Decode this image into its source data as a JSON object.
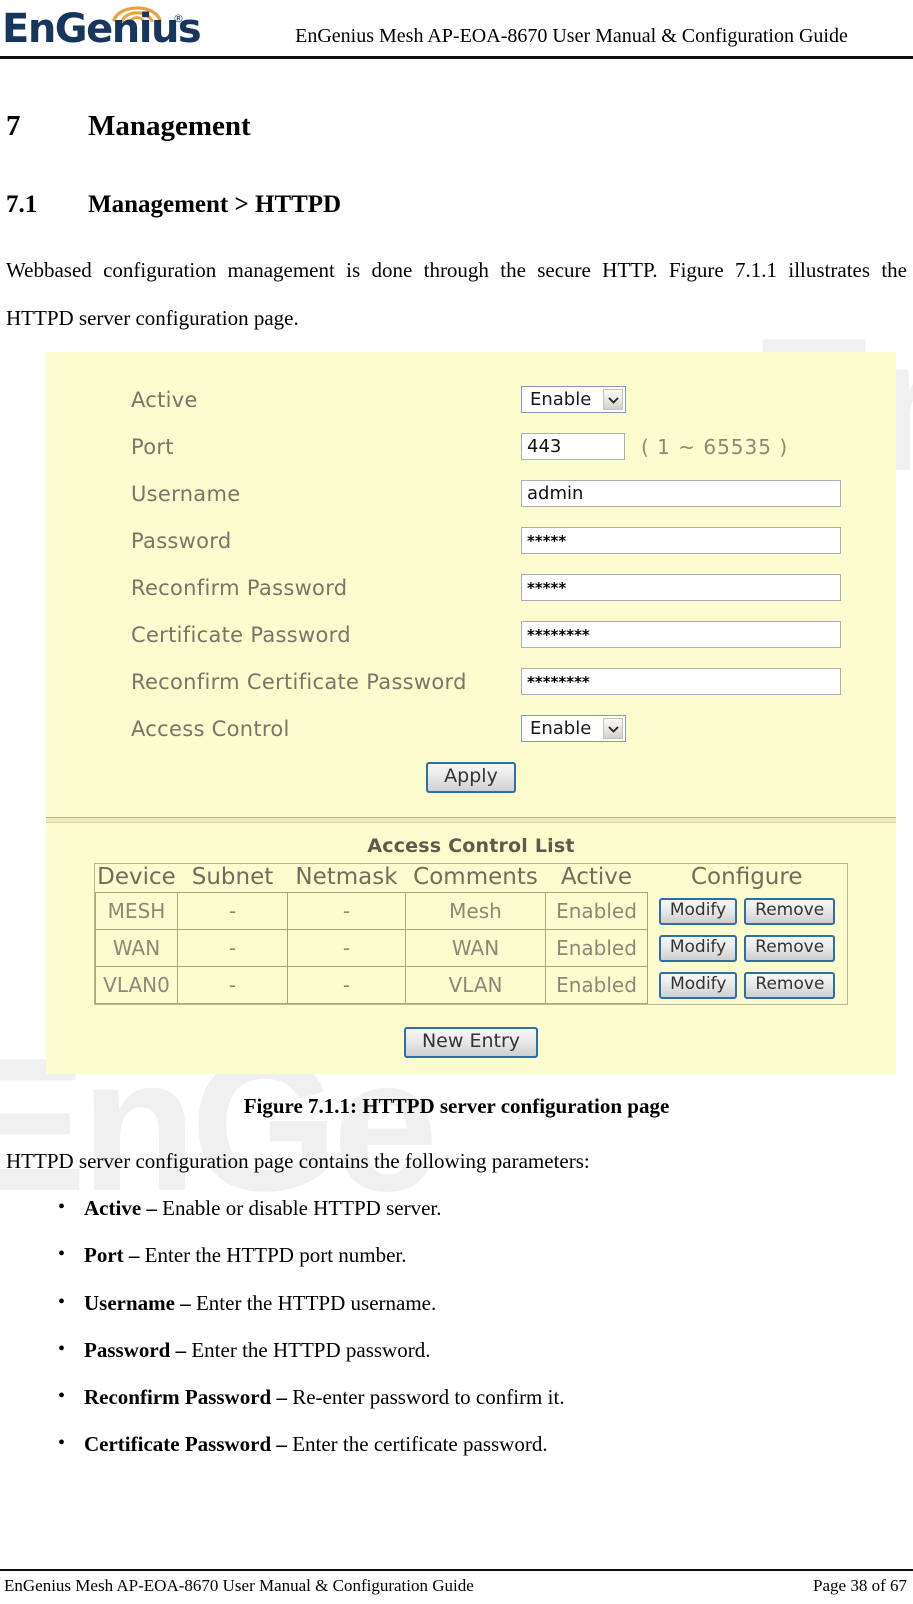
{
  "header": {
    "logo_text": "EnGenius",
    "logo_registered": "®",
    "title": "EnGenius Mesh AP-EOA-8670 User Manual & Configuration Guide"
  },
  "watermark": {
    "part1": "EnG",
    "part2": "EnGe"
  },
  "section": {
    "number": "7",
    "title": "Management"
  },
  "subsection": {
    "number": "7.1",
    "title": "Management > HTTPD"
  },
  "intro_paragraph": "Webbased configuration management is done through the secure HTTP. Figure 7.1.1 illustrates the HTTPD server configuration page.",
  "figure": {
    "caption": "Figure 7.1.1: HTTPD server configuration page",
    "form": {
      "rows": [
        {
          "label": "Active",
          "control": "select",
          "value": "Enable"
        },
        {
          "label": "Port",
          "control": "text",
          "value": "443",
          "hint": "( 1 ~ 65535 )"
        },
        {
          "label": "Username",
          "control": "text",
          "value": "admin"
        },
        {
          "label": "Password",
          "control": "password",
          "value": "*****"
        },
        {
          "label": "Reconfirm Password",
          "control": "password",
          "value": "*****"
        },
        {
          "label": "Certificate Password",
          "control": "password",
          "value": "********"
        },
        {
          "label": "Reconfirm Certificate Password",
          "control": "password",
          "value": "********"
        },
        {
          "label": "Access Control",
          "control": "select",
          "value": "Enable"
        }
      ],
      "apply_label": "Apply"
    },
    "acl": {
      "title": "Access Control List",
      "columns": [
        "Device",
        "Subnet",
        "Netmask",
        "Comments",
        "Active",
        "Configure"
      ],
      "rows": [
        {
          "device": "MESH",
          "subnet": "-",
          "netmask": "-",
          "comments": "Mesh",
          "active": "Enabled",
          "modify_label": "Modify",
          "remove_label": "Remove"
        },
        {
          "device": "WAN",
          "subnet": "-",
          "netmask": "-",
          "comments": "WAN",
          "active": "Enabled",
          "modify_label": "Modify",
          "remove_label": "Remove"
        },
        {
          "device": "VLAN0",
          "subnet": "-",
          "netmask": "-",
          "comments": "VLAN",
          "active": "Enabled",
          "modify_label": "Modify",
          "remove_label": "Remove"
        }
      ],
      "new_entry_label": "New Entry"
    }
  },
  "params_lead": "HTTPD server configuration page contains the following parameters:",
  "params": [
    {
      "term": "Active –",
      "desc": " Enable or disable HTTPD server."
    },
    {
      "term": "Port –",
      "desc": " Enter the HTTPD port number."
    },
    {
      "term": "Username –",
      "desc": " Enter the HTTPD username."
    },
    {
      "term": "Password –",
      "desc": " Enter the HTTPD password."
    },
    {
      "term": "Reconfirm Password –",
      "desc": " Re-enter password to confirm it."
    },
    {
      "term": "Certificate Password –",
      "desc": " Enter the certificate password."
    }
  ],
  "footer": {
    "left": "EnGenius Mesh AP-EOA-8670 User Manual & Configuration Guide",
    "right": "Page 38 of 67"
  },
  "colors": {
    "logo_navy": "#17365d",
    "logo_orange": "#e8a33d",
    "panel_bg": "#fdfccf",
    "label_gray": "#76766a",
    "button_border_blue": "#2f6fa8"
  }
}
